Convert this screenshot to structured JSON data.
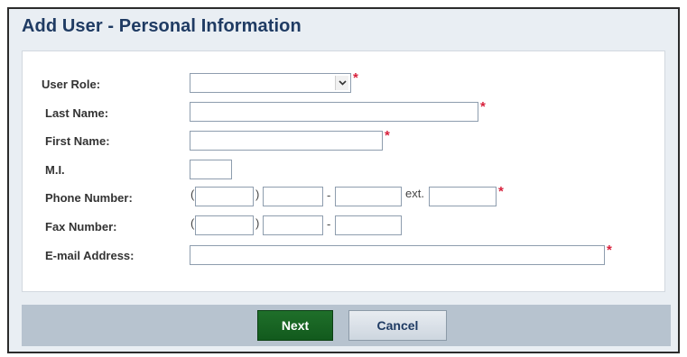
{
  "dialog": {
    "title": "Add User - Personal Information"
  },
  "form": {
    "user_role": {
      "label": "User Role:",
      "value": ""
    },
    "last_name": {
      "label": "Last Name:",
      "value": ""
    },
    "first_name": {
      "label": "First Name:",
      "value": ""
    },
    "middle_initial": {
      "label": "M.I.",
      "value": ""
    },
    "phone": {
      "label": "Phone Number:",
      "open_paren": "(",
      "close_paren": ")",
      "dash": "-",
      "ext_label": "ext."
    },
    "fax": {
      "label": "Fax Number:",
      "open_paren": "(",
      "close_paren": ")",
      "dash": "-"
    },
    "email": {
      "label": "E-mail Address:",
      "value": ""
    },
    "required_marker": "*"
  },
  "footer": {
    "next_label": "Next",
    "cancel_label": "Cancel"
  },
  "colors": {
    "title": "#1f3b63",
    "required": "#d8213c",
    "next_button": "#1f6f2a",
    "footer_bar": "#b7c3cf"
  },
  "icons": {
    "select_arrow": "chevron-down-icon"
  }
}
